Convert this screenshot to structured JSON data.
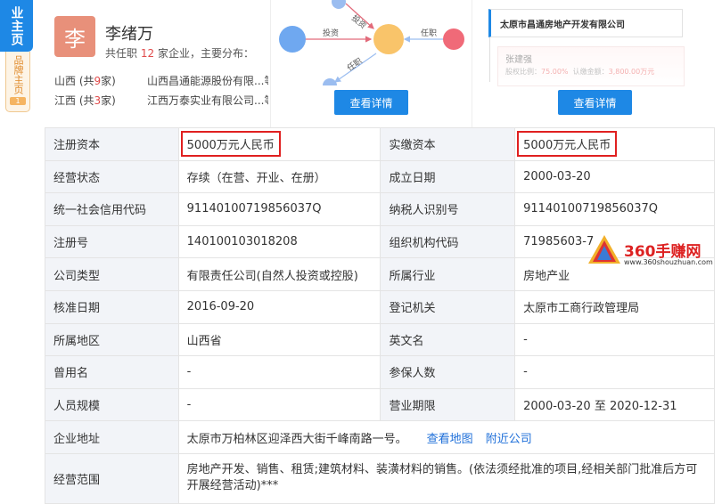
{
  "side_tabs": {
    "main": "业主页",
    "brand": "品牌主页",
    "brand_count": "1"
  },
  "person": {
    "avatar_char": "李",
    "name": "李绪万",
    "summary_prefix": "共任职",
    "summary_count": "12",
    "summary_suffix": "家企业，主要分布：",
    "regions": [
      {
        "province": "山西",
        "prefix": " (共",
        "count": "9",
        "suffix": "家)",
        "companies": "山西昌通能源股份有限...等"
      },
      {
        "province": "江西",
        "prefix": " (共",
        "count": "3",
        "suffix": "家)",
        "companies": "江西万泰实业有限公司...等"
      }
    ]
  },
  "graph": {
    "edge_labels": [
      "投资",
      "投资",
      "任职",
      "任职"
    ],
    "colors": {
      "left": "#6fa8f0",
      "center": "#f9c46a",
      "right": "#f06a78",
      "edge": "#9bbdf0"
    }
  },
  "tree": {
    "root": "太原市昌通房地产开发有限公司",
    "child_name": "张建强",
    "child_detail_a": "股权比例：",
    "child_detail_a_val": "75.00%",
    "child_detail_b": "认缴金额：",
    "child_detail_b_val": "3,800.00万元"
  },
  "buttons": {
    "detail_graph": "查看详情",
    "detail_tree": "查看详情"
  },
  "table": {
    "rows": [
      {
        "l1": "注册资本",
        "v1": "5000万元人民币",
        "l2": "实缴资本",
        "v2": "5000万元人民币"
      },
      {
        "l1": "经营状态",
        "v1": "存续（在营、开业、在册）",
        "l2": "成立日期",
        "v2": "2000-03-20"
      },
      {
        "l1": "统一社会信用代码",
        "v1": "91140100719856037Q",
        "l2": "纳税人识别号",
        "v2": "91140100719856037Q"
      },
      {
        "l1": "注册号",
        "v1": "140100103018208",
        "l2": "组织机构代码",
        "v2": "71985603-7"
      },
      {
        "l1": "公司类型",
        "v1": "有限责任公司(自然人投资或控股)",
        "l2": "所属行业",
        "v2": "房地产业"
      },
      {
        "l1": "核准日期",
        "v1": "2016-09-20",
        "l2": "登记机关",
        "v2": "太原市工商行政管理局"
      },
      {
        "l1": "所属地区",
        "v1": "山西省",
        "l2": "英文名",
        "v2": "-"
      },
      {
        "l1": "曾用名",
        "v1": "-",
        "l2": "参保人数",
        "v2": "-"
      },
      {
        "l1": "人员规模",
        "v1": "-",
        "l2": "营业期限",
        "v2": "2000-03-20 至 2020-12-31"
      }
    ],
    "address_label": "企业地址",
    "address_value": "太原市万柏林区迎泽西大街千峰南路一号。",
    "address_link_map": "查看地图",
    "address_link_nearby": "附近公司",
    "scope_label": "经营范围",
    "scope_value": "房地产开发、销售、租赁;建筑材料、装潢材料的销售。(依法须经批准的项目,经相关部门批准后方可开展经营活动)***"
  },
  "watermark": {
    "title": "360手赚网",
    "url": "www.360shouzhuan.com"
  }
}
